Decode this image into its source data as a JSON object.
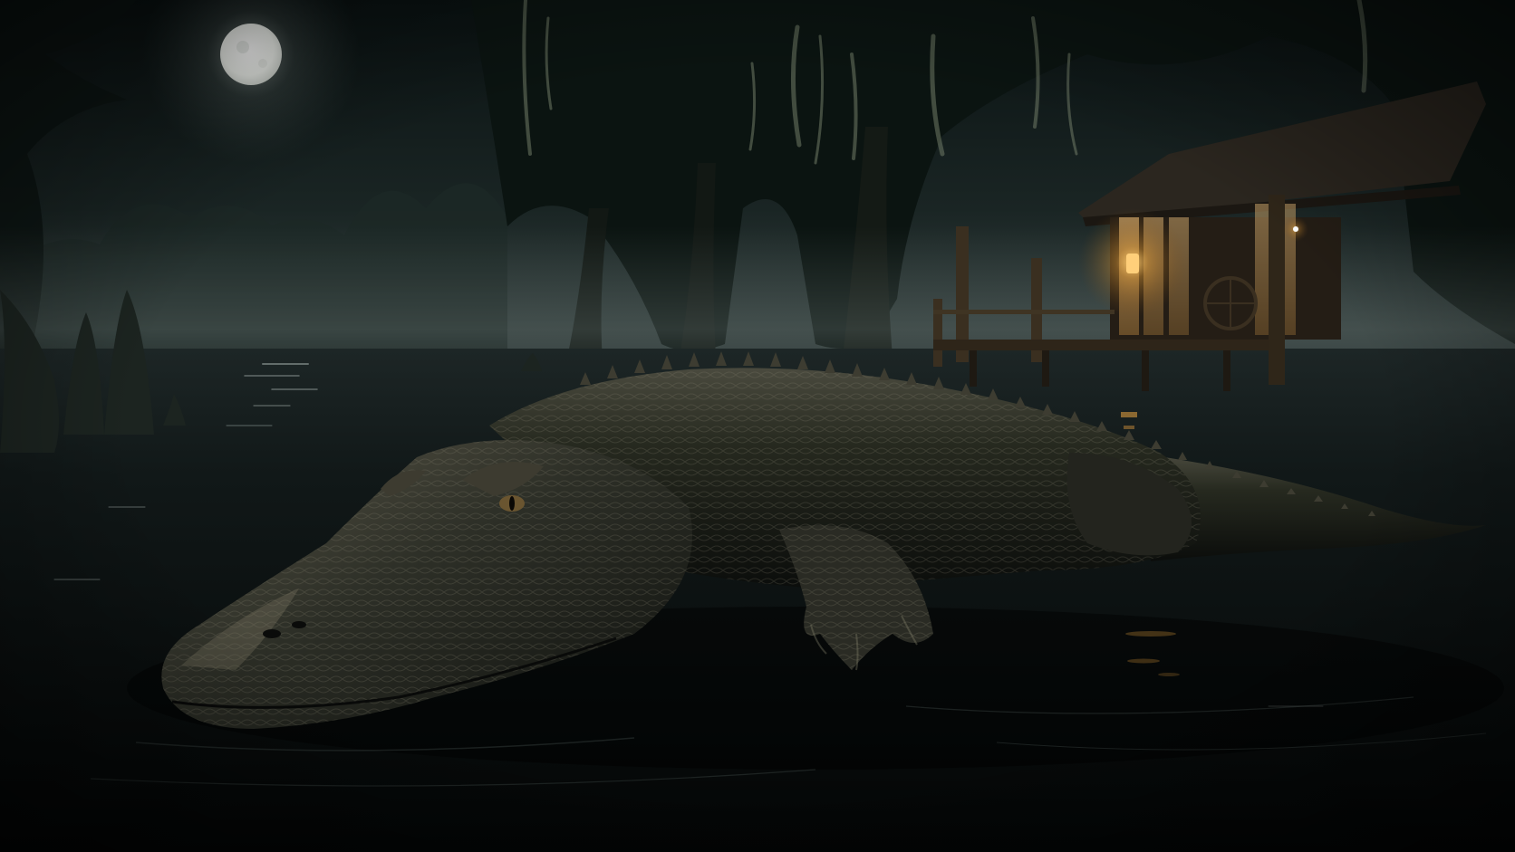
{
  "scene": {
    "elements": [
      {
        "name": "full-moon",
        "kind": "moon"
      },
      {
        "name": "night-sky",
        "kind": "sky"
      },
      {
        "name": "cypress-forest",
        "kind": "trees"
      },
      {
        "name": "spanish-moss",
        "kind": "moss"
      },
      {
        "name": "swamp-mist",
        "kind": "fog"
      },
      {
        "name": "cypress-knees",
        "kind": "stumps"
      },
      {
        "name": "swamp-water",
        "kind": "water"
      },
      {
        "name": "stilt-cabin",
        "kind": "building"
      },
      {
        "name": "lantern-glow",
        "kind": "light"
      },
      {
        "name": "alligator",
        "kind": "animal"
      }
    ]
  },
  "palette": {
    "sky_top": "#0b1414",
    "sky_mist": "#3d4a49",
    "moon": "#f4f6f2",
    "forest": "#0e1a15",
    "moss": "#6f7a66",
    "water_top": "#1a2222",
    "water_bottom": "#030505",
    "gator_dark": "#121513",
    "gator_mid": "#2b2f28",
    "gator_highlight": "#7a7562",
    "wood": "#2a2218",
    "lantern": "#ffb84a"
  }
}
